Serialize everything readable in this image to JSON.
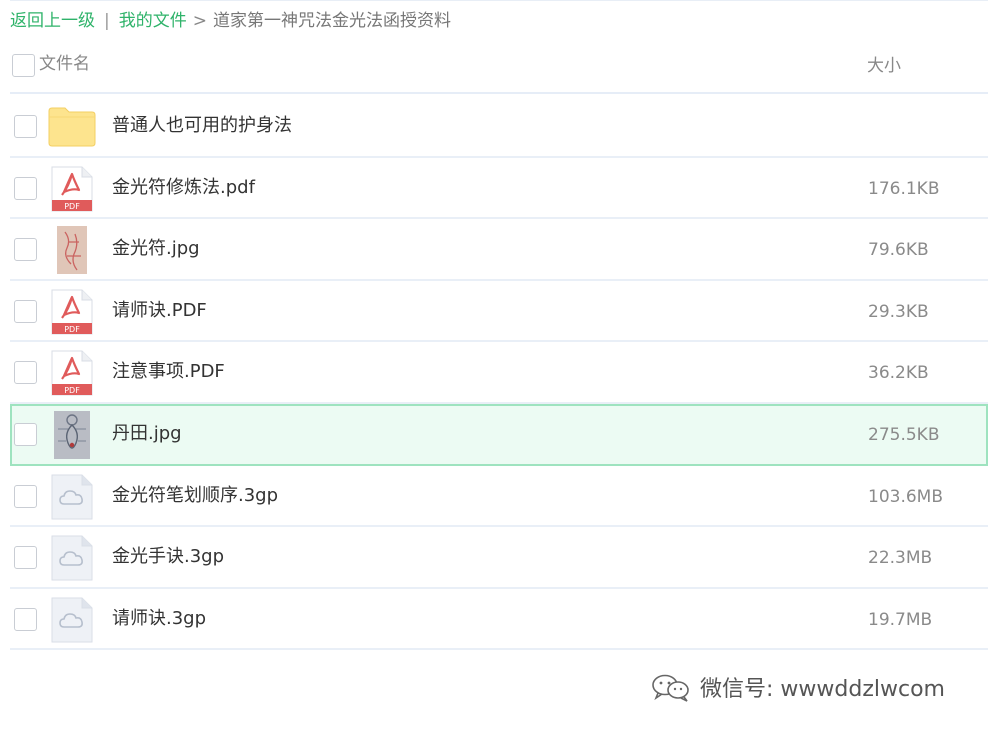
{
  "breadcrumb": {
    "back_label": "返回上一级",
    "separator": "|",
    "root_label": "我的文件",
    "arrow": ">",
    "current_label": "道家第一神咒法金光法函授资料"
  },
  "header": {
    "name_label": "文件名",
    "size_label": "大小"
  },
  "files": [
    {
      "name": "普通人也可用的护身法",
      "size": "",
      "type": "folder-icon"
    },
    {
      "name": "金光符修炼法.pdf",
      "size": "176.1KB",
      "type": "pdf-icon"
    },
    {
      "name": "金光符.jpg",
      "size": "79.6KB",
      "type": "image-thumbnail"
    },
    {
      "name": "请师诀.PDF",
      "size": "29.3KB",
      "type": "pdf-icon"
    },
    {
      "name": "注意事项.PDF",
      "size": "36.2KB",
      "type": "pdf-icon"
    },
    {
      "name": "丹田.jpg",
      "size": "275.5KB",
      "type": "image-thumbnail",
      "selected": true
    },
    {
      "name": "金光符笔划顺序.3gp",
      "size": "103.6MB",
      "type": "cloud-file-icon"
    },
    {
      "name": "金光手诀.3gp",
      "size": "22.3MB",
      "type": "cloud-file-icon"
    },
    {
      "name": "请师诀.3gp",
      "size": "19.7MB",
      "type": "cloud-file-icon"
    }
  ],
  "pdf_badge": "PDF",
  "watermark": {
    "text": "微信号: wwwddzlwcom"
  },
  "colors": {
    "link": "#2fb36a",
    "selected_bg": "#ecfbf3",
    "selected_border": "#9ee3bf",
    "pdf_red": "#e05b5b",
    "folder_yellow": "#fde48e"
  }
}
